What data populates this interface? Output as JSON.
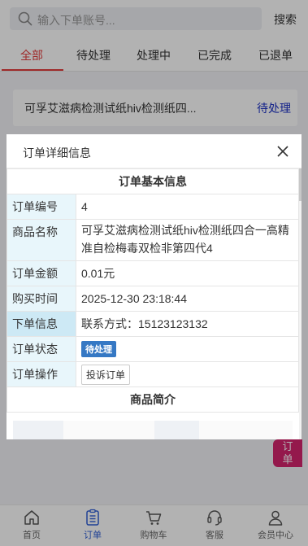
{
  "search": {
    "placeholder": "输入下单账号...",
    "button": "搜索"
  },
  "tabs": [
    {
      "label": "全部",
      "active": true
    },
    {
      "label": "待处理"
    },
    {
      "label": "处理中"
    },
    {
      "label": "已完成"
    },
    {
      "label": "已退单"
    }
  ],
  "order_card": {
    "title": "可孚艾滋病检测试纸hiv检测纸四...",
    "status": "待处理"
  },
  "modal": {
    "title": "订单详细信息",
    "section_basic": "订单基本信息",
    "rows": {
      "order_no": {
        "label": "订单编号",
        "value": "4"
      },
      "product": {
        "label": "商品名称",
        "value": "可孚艾滋病检测试纸hiv检测纸四合一高精准自检梅毒双检非第四代4"
      },
      "amount": {
        "label": "订单金额",
        "value": "0.01元"
      },
      "time": {
        "label": "购买时间",
        "value": "2025-12-30 23:18:44"
      },
      "info": {
        "label": "下单信息",
        "value": "联系方式：15123123132"
      },
      "status": {
        "label": "订单状态",
        "value": "待处理"
      },
      "action": {
        "label": "订单操作",
        "value": "投诉订单"
      }
    },
    "section_intro": "商品简介"
  },
  "float_badge": {
    "line1": "订",
    "line2": "单"
  },
  "bottom_nav": [
    {
      "label": "首页",
      "icon": "home-icon"
    },
    {
      "label": "订单",
      "icon": "order-icon",
      "active": true
    },
    {
      "label": "购物车",
      "icon": "cart-icon"
    },
    {
      "label": "客服",
      "icon": "headset-icon"
    },
    {
      "label": "会员中心",
      "icon": "user-icon"
    }
  ],
  "colors": {
    "accent_red": "#e23b3b",
    "accent_blue": "#2f5ed6",
    "badge_pink": "#d4246e",
    "status_blue": "#3578c4"
  }
}
